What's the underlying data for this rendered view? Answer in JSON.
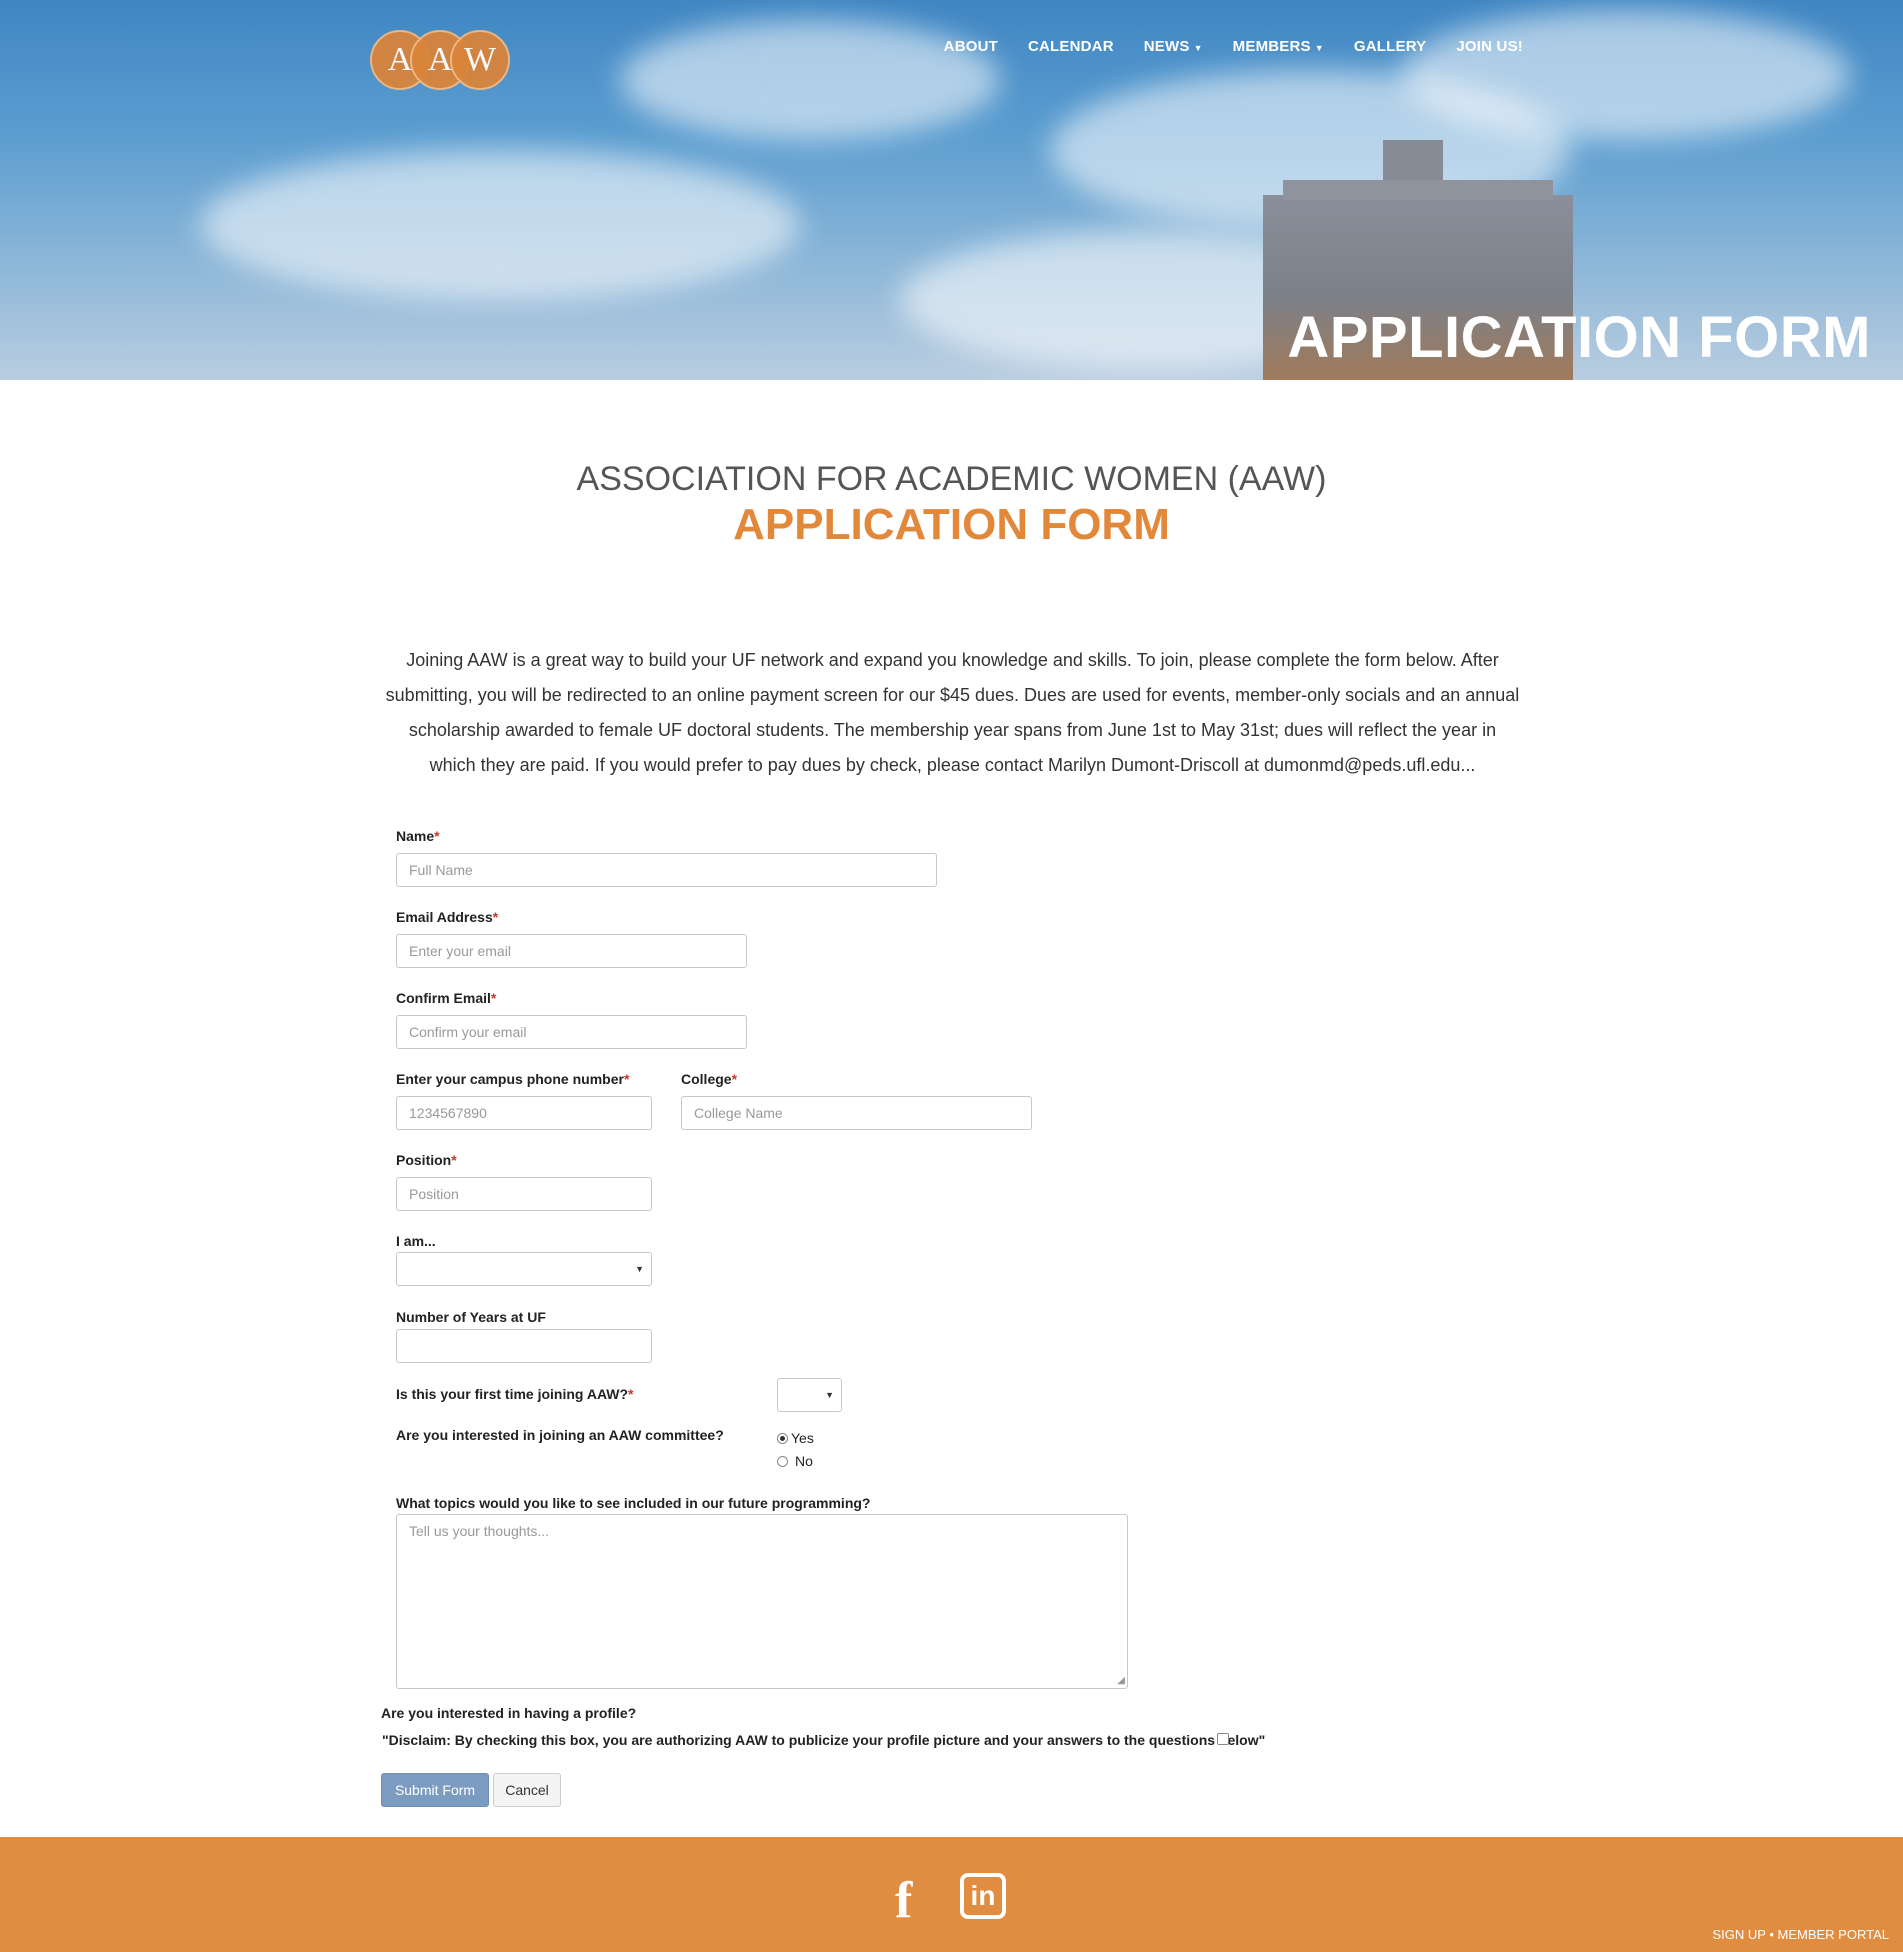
{
  "logo": {
    "letters": [
      "A",
      "A",
      "W"
    ]
  },
  "nav": {
    "about": "ABOUT",
    "calendar": "CALENDAR",
    "news": "NEWS",
    "members": "MEMBERS",
    "gallery": "GALLERY",
    "join": "JOIN US!"
  },
  "hero": {
    "title": "APPLICATION FORM"
  },
  "heading": {
    "org": "ASSOCIATION FOR ACADEMIC WOMEN (AAW)",
    "subtitle": "APPLICATION FORM"
  },
  "intro": "Joining AAW is a great way to build your UF network and expand you knowledge and skills. To join, please complete the form below. After submitting, you will be redirected to an online payment screen for our $45 dues. Dues are used for events, member-only socials and an annual scholarship awarded to female UF doctoral students. The membership year spans from June 1st to May 31st; dues will reflect the year in which they are paid. If you would prefer to pay dues by check, please contact Marilyn Dumont-Driscoll at dumonmd@peds.ufl.edu...",
  "form": {
    "name": {
      "label": "Name",
      "placeholder": "Full Name"
    },
    "email": {
      "label": "Email Address",
      "placeholder": "Enter your email"
    },
    "confirm_email": {
      "label": "Confirm Email",
      "placeholder": "Confirm your email"
    },
    "phone": {
      "label": "Enter your campus phone number",
      "placeholder": "1234567890"
    },
    "college": {
      "label": "College",
      "placeholder": "College Name"
    },
    "position": {
      "label": "Position",
      "placeholder": "Position"
    },
    "i_am": {
      "label": "I am...",
      "value": ""
    },
    "years": {
      "label": "Number of Years at UF",
      "value": ""
    },
    "first_time": {
      "label": "Is this your first time joining AAW?",
      "value": ""
    },
    "committee": {
      "label": "Are you interested in joining an AAW committee?",
      "options": [
        "Yes",
        "No"
      ],
      "selected": "Yes"
    },
    "topics": {
      "label": "What topics would you like to see included in our future programming?",
      "placeholder": "Tell us your thoughts..."
    },
    "profile_question": "Are you interested in having a profile?",
    "disclaimer": "\"Disclaim: By checking this box, you are authorizing AAW to publicize your profile picture and your answers to the questions below\"",
    "required_mark": "*",
    "submit": "Submit Form",
    "cancel": "Cancel"
  },
  "footer": {
    "links": "SIGN UP • MEMBER PORTAL",
    "icons": [
      "facebook-icon",
      "linkedin-icon"
    ]
  },
  "colors": {
    "accent": "#e2883a",
    "footer": "#e08d42",
    "submit": "#7b9cc0",
    "required": "#c0392b"
  }
}
